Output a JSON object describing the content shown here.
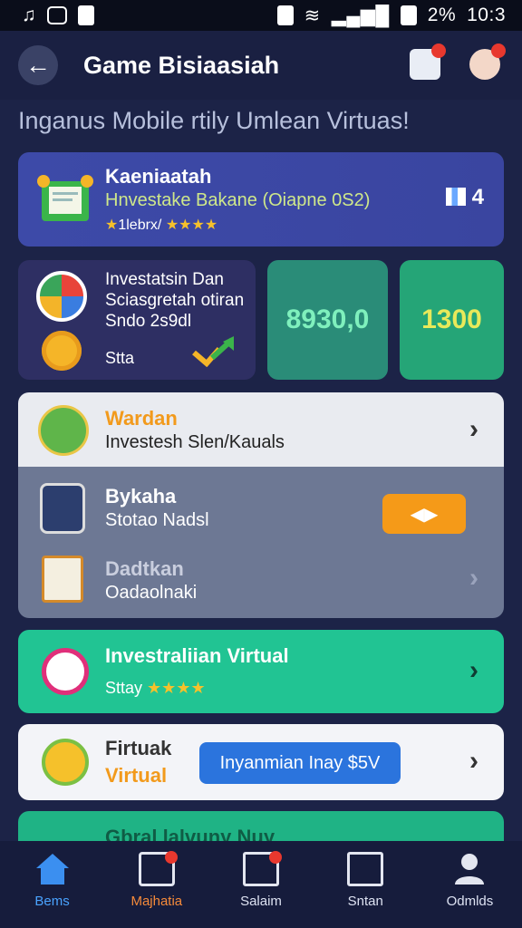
{
  "status_bar": {
    "time": "10:3",
    "battery": "2%"
  },
  "app_bar": {
    "title": "Game Bisiaasiah"
  },
  "subtitle": "Inganus Mobile rtily Umlean Virtuas!",
  "featured": {
    "title": "Kaeniaatah",
    "subtitle": "Hnvestake Bakane (Oiapne 0S2)",
    "rating_label": "1lebrx/",
    "rating_stars": "★★★★",
    "badge": "4"
  },
  "invest_card": {
    "lines": [
      "Investatsin Dan",
      "Sciasgretah otiran",
      "Sndo 2s9dl"
    ],
    "label": "Stta"
  },
  "stats": [
    "8930,0",
    "1300"
  ],
  "list": [
    {
      "title": "Wardan",
      "subtitle": "Investesh Slen/Kauals"
    },
    {
      "title": "Bykaha",
      "subtitle": "Stotao Nadsl"
    },
    {
      "title": "Dadtkan",
      "subtitle": "Oadaolnaki"
    }
  ],
  "promo": {
    "title": "Investraliian Virtual",
    "rating_label": "Sttay",
    "rating_stars": "★★★★"
  },
  "feature": {
    "title_line1": "Firtuak",
    "title_line2": "Virtual",
    "button": "Inyanmian Inay $5V"
  },
  "peek": {
    "text": "Gbral lalvuny Nuy"
  },
  "bottom_nav": [
    {
      "label": "Bems"
    },
    {
      "label": "Majhatia"
    },
    {
      "label": "Salaim"
    },
    {
      "label": "Sntan"
    },
    {
      "label": "Odmlds"
    }
  ],
  "colors": {
    "accent_green": "#21c493",
    "accent_orange": "#f59a18",
    "accent_blue": "#2b74dd"
  }
}
